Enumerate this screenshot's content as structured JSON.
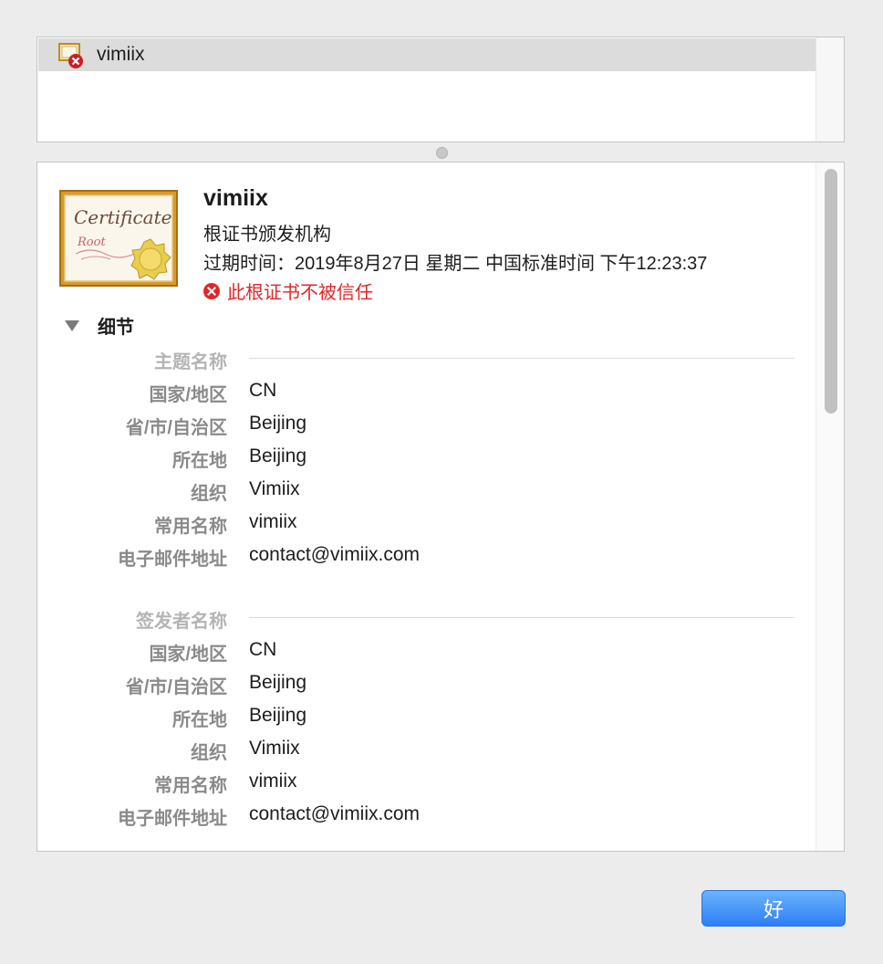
{
  "cert_list": {
    "items": [
      {
        "label": "vimiix"
      }
    ]
  },
  "detail": {
    "cert_image_text": "Certificate",
    "cert_image_subtext": "Root",
    "name": "vimiix",
    "type": "根证书颁发机构",
    "expiry": "过期时间：2019年8月27日 星期二 中国标准时间 下午12:23:37",
    "warning": "此根证书不被信任",
    "details_label": "细节",
    "subject": {
      "title": "主题名称",
      "rows": [
        {
          "label": "国家/地区",
          "value": "CN"
        },
        {
          "label": "省/市/自治区",
          "value": "Beijing"
        },
        {
          "label": "所在地",
          "value": "Beijing"
        },
        {
          "label": "组织",
          "value": "Vimiix"
        },
        {
          "label": "常用名称",
          "value": "vimiix"
        },
        {
          "label": "电子邮件地址",
          "value": "contact@vimiix.com"
        }
      ]
    },
    "issuer": {
      "title": "签发者名称",
      "rows": [
        {
          "label": "国家/地区",
          "value": "CN"
        },
        {
          "label": "省/市/自治区",
          "value": "Beijing"
        },
        {
          "label": "所在地",
          "value": "Beijing"
        },
        {
          "label": "组织",
          "value": "Vimiix"
        },
        {
          "label": "常用名称",
          "value": "vimiix"
        },
        {
          "label": "电子邮件地址",
          "value": "contact@vimiix.com"
        }
      ]
    }
  },
  "buttons": {
    "ok_label": "好"
  },
  "colors": {
    "warning": "#e0262b",
    "accent": "#2d7ff6"
  },
  "icons": {
    "list_item": "certificate-error-icon",
    "warning": "error-circle-icon",
    "toggle": "disclosure-triangle-icon"
  }
}
